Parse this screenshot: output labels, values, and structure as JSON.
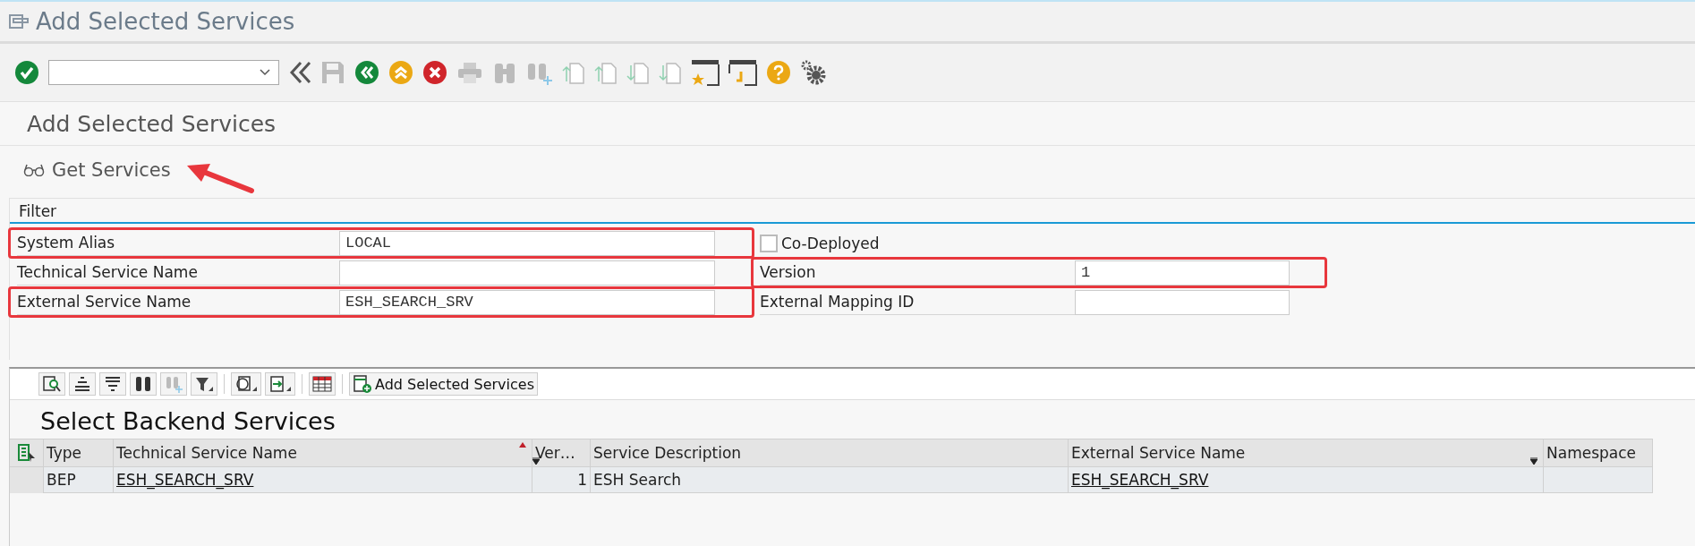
{
  "window": {
    "title": "Add Selected Services"
  },
  "page_title": "Add Selected Services",
  "actions": [
    {
      "label": "Get Services"
    }
  ],
  "filter": {
    "title": "Filter",
    "left": [
      {
        "kind": "field",
        "label": "System Alias",
        "value": "LOCAL",
        "highlighted": true
      },
      {
        "kind": "field",
        "label": "Technical Service Name",
        "highlighted": false
      },
      {
        "kind": "field",
        "label": "External Service Name",
        "value": "ESH_SEARCH_SRV",
        "highlighted": true
      }
    ],
    "right": [
      {
        "kind": "checkbox",
        "label": "Co-Deployed",
        "checked": false,
        "highlighted": false
      },
      {
        "kind": "field",
        "label": "Version",
        "value": "1",
        "highlighted": true
      },
      {
        "kind": "field",
        "label": "External Mapping ID",
        "highlighted": false
      }
    ]
  },
  "table": {
    "toolbar_button": "Add Selected Services",
    "title": "Select Backend Services",
    "columns": [
      {
        "label": "Type",
        "kind": "text",
        "sorted": false,
        "filtered": false
      },
      {
        "label": "Technical Service Name",
        "kind": "link",
        "sorted": true,
        "filtered": false
      },
      {
        "label": "Ver…",
        "kind": "number",
        "sorted": false,
        "filtered": true
      },
      {
        "label": "Service Description",
        "kind": "text",
        "sorted": false,
        "filtered": false
      },
      {
        "label": "External Service Name",
        "kind": "link",
        "sorted": false,
        "filtered": true
      },
      {
        "label": "Namespace",
        "kind": "text",
        "sorted": false,
        "filtered": false
      }
    ],
    "rows": [
      {
        "cells": [
          "BEP",
          "ESH_SEARCH_SRV",
          "1",
          "ESH Search",
          "ESH_SEARCH_SRV"
        ]
      }
    ]
  }
}
